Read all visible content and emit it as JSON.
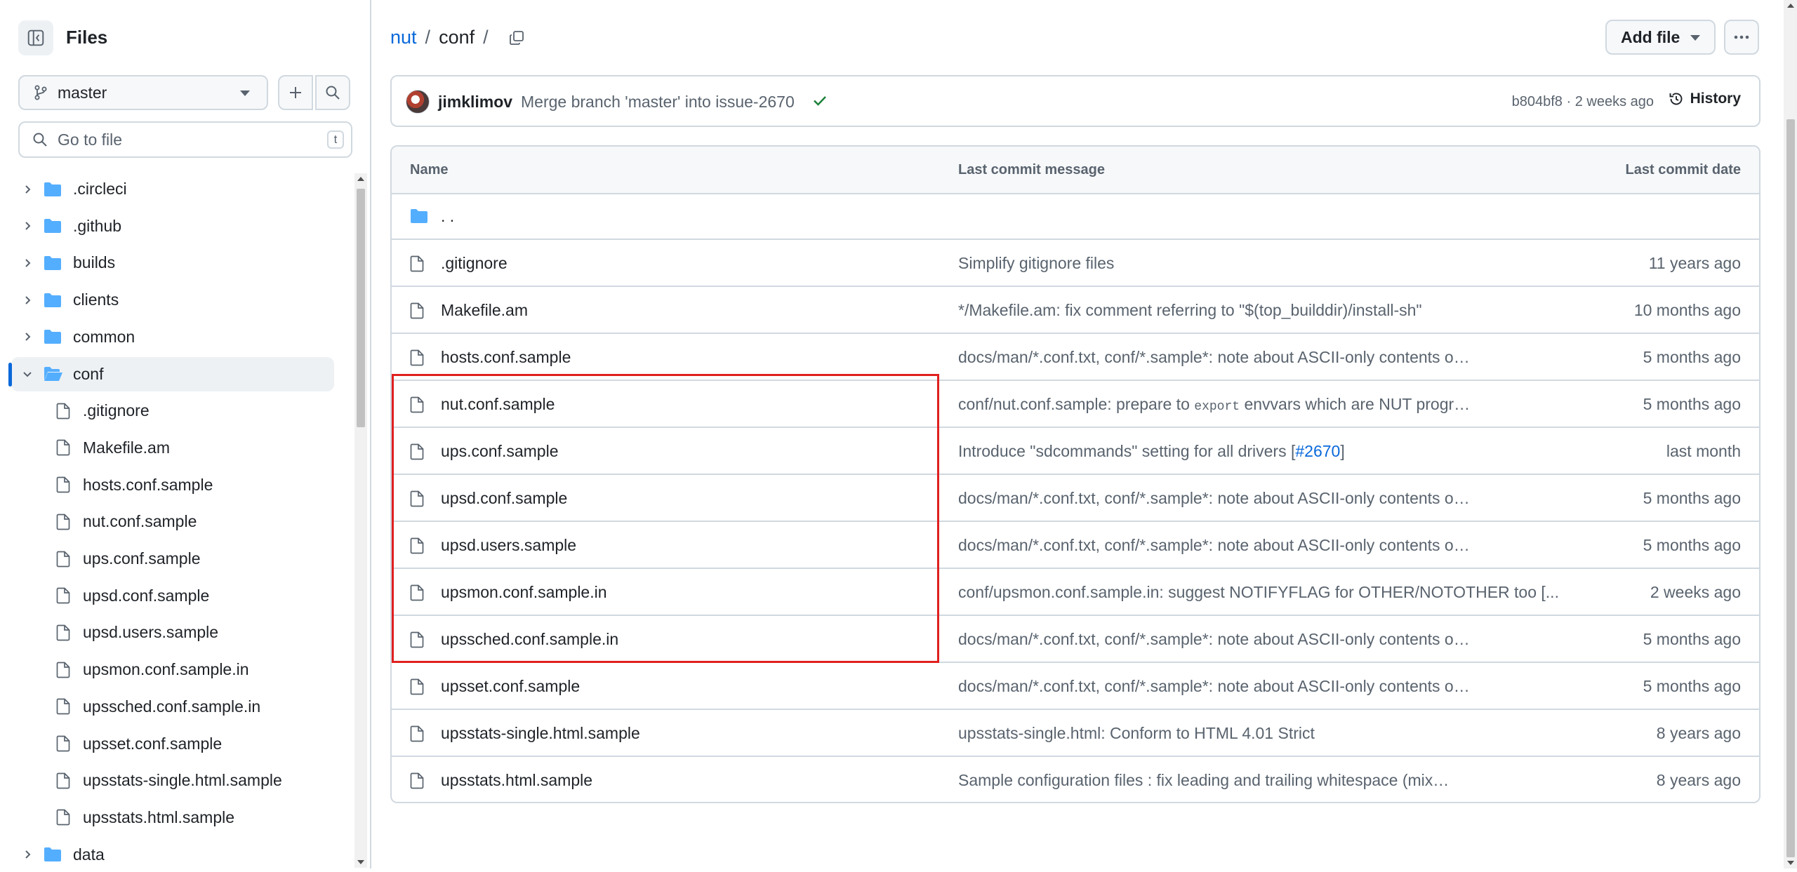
{
  "sidebar": {
    "title": "Files",
    "branch": "master",
    "goto_placeholder": "Go to file",
    "goto_shortcut": "t",
    "tree": [
      {
        "name": ".circleci",
        "type": "folder",
        "expanded": false,
        "active": false,
        "depth": 0
      },
      {
        "name": ".github",
        "type": "folder",
        "expanded": false,
        "active": false,
        "depth": 0
      },
      {
        "name": "builds",
        "type": "folder",
        "expanded": false,
        "active": false,
        "depth": 0
      },
      {
        "name": "clients",
        "type": "folder",
        "expanded": false,
        "active": false,
        "depth": 0
      },
      {
        "name": "common",
        "type": "folder",
        "expanded": false,
        "active": false,
        "depth": 0
      },
      {
        "name": "conf",
        "type": "folder",
        "expanded": true,
        "active": true,
        "depth": 0
      },
      {
        "name": ".gitignore",
        "type": "file",
        "depth": 1
      },
      {
        "name": "Makefile.am",
        "type": "file",
        "depth": 1
      },
      {
        "name": "hosts.conf.sample",
        "type": "file",
        "depth": 1
      },
      {
        "name": "nut.conf.sample",
        "type": "file",
        "depth": 1
      },
      {
        "name": "ups.conf.sample",
        "type": "file",
        "depth": 1
      },
      {
        "name": "upsd.conf.sample",
        "type": "file",
        "depth": 1
      },
      {
        "name": "upsd.users.sample",
        "type": "file",
        "depth": 1
      },
      {
        "name": "upsmon.conf.sample.in",
        "type": "file",
        "depth": 1
      },
      {
        "name": "upssched.conf.sample.in",
        "type": "file",
        "depth": 1
      },
      {
        "name": "upsset.conf.sample",
        "type": "file",
        "depth": 1
      },
      {
        "name": "upsstats-single.html.sample",
        "type": "file",
        "depth": 1
      },
      {
        "name": "upsstats.html.sample",
        "type": "file",
        "depth": 1
      },
      {
        "name": "data",
        "type": "folder",
        "expanded": false,
        "active": false,
        "depth": 0
      }
    ]
  },
  "header": {
    "breadcrumb_repo": "nut",
    "breadcrumb_sep": "/",
    "breadcrumb_dir": "conf",
    "add_file_label": "Add file"
  },
  "commit": {
    "author": "jimklimov",
    "message": "Merge branch 'master' into issue-2670",
    "hash_date": "b804bf8 · 2 weeks ago",
    "history_label": "History"
  },
  "table": {
    "col_name": "Name",
    "col_message": "Last commit message",
    "col_date": "Last commit date",
    "parent_label": ". .",
    "rows": [
      {
        "name": ".gitignore",
        "message": "Simplify gitignore files",
        "date": "11 years ago"
      },
      {
        "name": "Makefile.am",
        "message": "*/Makefile.am: fix comment referring to \"$(top_builddir)/install-sh\"",
        "date": "10 months ago"
      },
      {
        "name": "hosts.conf.sample",
        "message": "docs/man/*.conf.txt, conf/*.sample*: note about ASCII-only contents o…",
        "date": "5 months ago"
      },
      {
        "name": "nut.conf.sample",
        "message_pre": "conf/nut.conf.sample: prepare to ",
        "message_code": "export",
        "message_post": " envvars which are NUT progr…",
        "date": "5 months ago"
      },
      {
        "name": "ups.conf.sample",
        "message_pre": "Introduce \"sdcommands\" setting for all drivers [",
        "message_link": "#2670",
        "message_post": "]",
        "date": "last month"
      },
      {
        "name": "upsd.conf.sample",
        "message": "docs/man/*.conf.txt, conf/*.sample*: note about ASCII-only contents o…",
        "date": "5 months ago"
      },
      {
        "name": "upsd.users.sample",
        "message": "docs/man/*.conf.txt, conf/*.sample*: note about ASCII-only contents o…",
        "date": "5 months ago"
      },
      {
        "name": "upsmon.conf.sample.in",
        "message": "conf/upsmon.conf.sample.in: suggest NOTIFYFLAG for OTHER/NOTOTHER too [...",
        "date": "2 weeks ago"
      },
      {
        "name": "upssched.conf.sample.in",
        "message": "docs/man/*.conf.txt, conf/*.sample*: note about ASCII-only contents o…",
        "date": "5 months ago"
      },
      {
        "name": "upsset.conf.sample",
        "message": "docs/man/*.conf.txt, conf/*.sample*: note about ASCII-only contents o…",
        "date": "5 months ago"
      },
      {
        "name": "upsstats-single.html.sample",
        "message": "upsstats-single.html: Conform to HTML 4.01 Strict",
        "date": "8 years ago"
      },
      {
        "name": "upsstats.html.sample",
        "message": "Sample configuration files : fix leading and trailing whitespace (mix…",
        "date": "8 years ago"
      }
    ]
  },
  "colors": {
    "accent": "#0969da",
    "folder": "#54aeff",
    "success": "#1a7f37",
    "highlight_box": "#e02020",
    "border": "#d1d9e0",
    "muted_text": "#59636e"
  }
}
